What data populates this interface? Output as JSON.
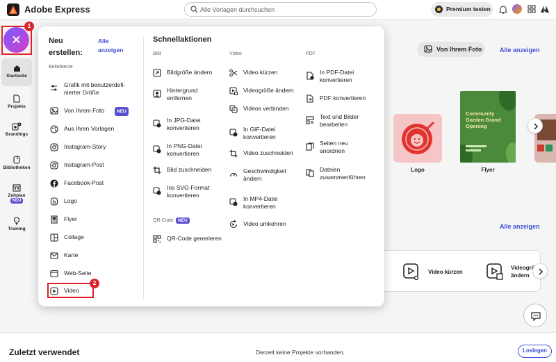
{
  "app": {
    "brand": "Adobe Express"
  },
  "search": {
    "placeholder": "Alle Vorlagen durchsuchen"
  },
  "header": {
    "premium_label": "Premium testen"
  },
  "rail": {
    "items": [
      {
        "label": "Startseite"
      },
      {
        "label": "Projekte"
      },
      {
        "label": "Brandings"
      },
      {
        "label": "Bibliotheken"
      },
      {
        "label": "Zeitplan",
        "badge": "NEU"
      },
      {
        "label": "Training"
      }
    ]
  },
  "annotations": {
    "marker1": "1",
    "marker2": "2"
  },
  "panel": {
    "heading": "Neu erstellen:",
    "heading_line1": "Neu",
    "heading_line2": "erstellen:",
    "view_all_line1": "Alle",
    "view_all_line2": "anzeigen",
    "popular_label": "Beliebteste",
    "create_items": [
      {
        "label_line1": "Grafik mit benutzerdefi-",
        "label_line2": "nierter Größe",
        "icon": "sliders-icon"
      },
      {
        "label": "Von Ihrem Foto",
        "badge": "NEU",
        "icon": "photo-icon"
      },
      {
        "label": "Aus Ihren Vorlagen",
        "icon": "palette-icon"
      },
      {
        "label": "Instagram-Story",
        "icon": "instagram-icon"
      },
      {
        "label": "Instagram-Post",
        "icon": "instagram-icon"
      },
      {
        "label": "Facebook-Post",
        "icon": "facebook-icon"
      },
      {
        "label": "Logo",
        "icon": "logo-icon"
      },
      {
        "label": "Flyer",
        "icon": "flyer-icon"
      },
      {
        "label": "Collage",
        "icon": "collage-icon"
      },
      {
        "label": "Karte",
        "icon": "card-icon"
      },
      {
        "label": "Web-Seite",
        "icon": "web-icon"
      },
      {
        "label": "Video",
        "icon": "video-icon"
      }
    ],
    "quick_actions_title": "Schnellaktionen",
    "columns": {
      "bild": {
        "label": "Bild",
        "items": [
          {
            "line1": "Bildgröße ändern",
            "icon": "resize-icon"
          },
          {
            "line1": "Hintergrund",
            "line2": "entfernen",
            "icon": "remove-bg-icon"
          },
          {
            "line1": "In JPG-Datei",
            "line2": "konvertieren",
            "icon": "convert-icon"
          },
          {
            "line1": "In PNG-Datei",
            "line2": "konvertieren",
            "icon": "convert-icon"
          },
          {
            "line1": "Bild zuschneiden",
            "icon": "crop-icon"
          },
          {
            "line1": "Ins SVG-Format",
            "line2": "konvertieren",
            "icon": "convert-icon"
          }
        ]
      },
      "qr": {
        "label": "QR-Code",
        "badge": "NEU",
        "items": [
          {
            "line1": "QR-Code generieren",
            "icon": "qr-icon"
          }
        ]
      },
      "video": {
        "label": "Video",
        "items": [
          {
            "line1": "Video kürzen",
            "icon": "trim-icon"
          },
          {
            "line1": "Videogröße ändern",
            "icon": "resize-icon"
          },
          {
            "line1": "Videos verbinden",
            "icon": "merge-icon"
          },
          {
            "line1": "In GIF-Datei",
            "line2": "konvertieren",
            "icon": "convert-icon"
          },
          {
            "line1": "Video zuschneiden",
            "icon": "crop-icon"
          },
          {
            "line1": "Geschwindigkeit",
            "line2": "ändern",
            "icon": "speed-icon"
          },
          {
            "line1": "In MP4-Datei",
            "line2": "konvertieren",
            "icon": "convert-icon"
          },
          {
            "line1": "Video umkehren",
            "icon": "reverse-icon"
          }
        ]
      },
      "pdf": {
        "label": "PDF",
        "items": [
          {
            "line1": "In PDF-Datei",
            "line2": "konvertieren",
            "icon": "pdf-icon"
          },
          {
            "line1": "PDF konvertieren",
            "icon": "pdf-icon"
          },
          {
            "line1": "Text und Bilder",
            "line2": "bearbeiten",
            "icon": "edit-icon"
          },
          {
            "line1": "Seiten neu",
            "line2": "anordnen",
            "icon": "pages-icon"
          },
          {
            "line1": "Dateien",
            "line2": "zusammenführen",
            "icon": "combine-icon"
          }
        ]
      }
    }
  },
  "main": {
    "from_photo_label": "Von Ihrem Foto",
    "view_all": "Alle anzeigen",
    "view_all_2": "Alle anzeigen",
    "cards": [
      {
        "label": "Logo",
        "logo_text": "CUPPA CHEER"
      },
      {
        "label": "Flyer",
        "flyer_title": "Community Garden Grand Opening"
      }
    ],
    "quick_strip": [
      {
        "label": "Video kürzen"
      },
      {
        "label_line1": "Videogrö",
        "label_line2": "ändern"
      }
    ],
    "colors": {
      "accent": "#3d4fd6",
      "logo_card": "#f6c6c6",
      "flyer_card": "#4a8a3a"
    }
  },
  "recent": {
    "title": "Zuletzt verwendet",
    "empty": "Derzeit keine Projekte vorhanden.",
    "button": "Loslegen"
  }
}
